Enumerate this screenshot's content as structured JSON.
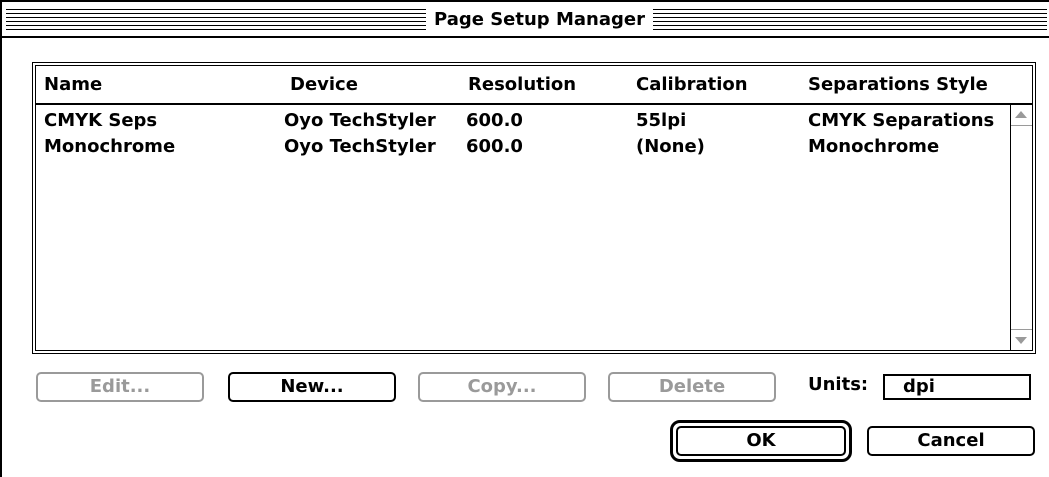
{
  "window": {
    "title": "Page Setup Manager"
  },
  "table": {
    "columns": [
      "Name",
      "Device",
      "Resolution",
      "Calibration",
      "Separations Style"
    ],
    "rows": [
      [
        "CMYK Seps",
        "Oyo TechStyler",
        "600.0",
        "55lpi",
        "CMYK Separations"
      ],
      [
        "Monochrome",
        "Oyo TechStyler",
        "600.0",
        "(None)",
        "Monochrome"
      ]
    ]
  },
  "buttons": {
    "edit": "Edit...",
    "new": "New...",
    "copy": "Copy...",
    "delete": "Delete",
    "ok": "OK",
    "cancel": "Cancel"
  },
  "units": {
    "label": "Units:",
    "value": "dpi"
  }
}
